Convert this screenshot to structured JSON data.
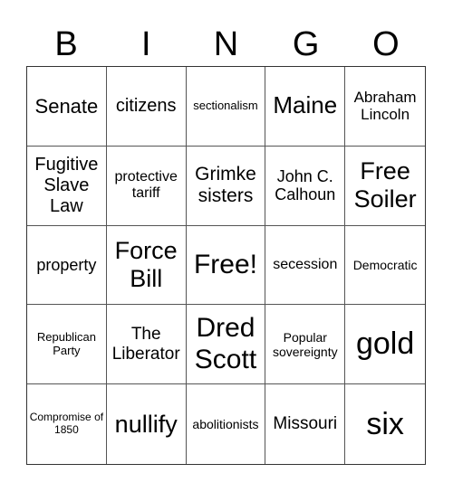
{
  "header": [
    "B",
    "I",
    "N",
    "G",
    "O"
  ],
  "cells": [
    {
      "text": "Senate",
      "size": "l"
    },
    {
      "text": "citizens",
      "size": "m"
    },
    {
      "text": "sectionalism",
      "size": "xs"
    },
    {
      "text": "Maine",
      "size": "xl"
    },
    {
      "text": "Abraham Lincoln",
      "size": "s"
    },
    {
      "text": "Fugitive Slave Law",
      "size": "m"
    },
    {
      "text": "protective tariff",
      "size": "s"
    },
    {
      "text": "Grimke sisters",
      "size": "m"
    },
    {
      "text": "John C. Calhoun",
      "size": "s"
    },
    {
      "text": "Free Soiler",
      "size": "xl"
    },
    {
      "text": "property",
      "size": "s"
    },
    {
      "text": "Force Bill",
      "size": "xl"
    },
    {
      "text": "Free!",
      "size": "xxl"
    },
    {
      "text": "secession",
      "size": "s"
    },
    {
      "text": "Democratic",
      "size": "xs"
    },
    {
      "text": "Republican Party",
      "size": "xs"
    },
    {
      "text": "The Liberator",
      "size": "m"
    },
    {
      "text": "Dred Scott",
      "size": "xxl"
    },
    {
      "text": "Popular sovereignty",
      "size": "xs"
    },
    {
      "text": "gold",
      "size": "xxxl"
    },
    {
      "text": "Compromise of 1850",
      "size": "xxs"
    },
    {
      "text": "nullify",
      "size": "xl"
    },
    {
      "text": "abolitionists",
      "size": "xs"
    },
    {
      "text": "Missouri",
      "size": "m"
    },
    {
      "text": "six",
      "size": "xxxl"
    }
  ]
}
